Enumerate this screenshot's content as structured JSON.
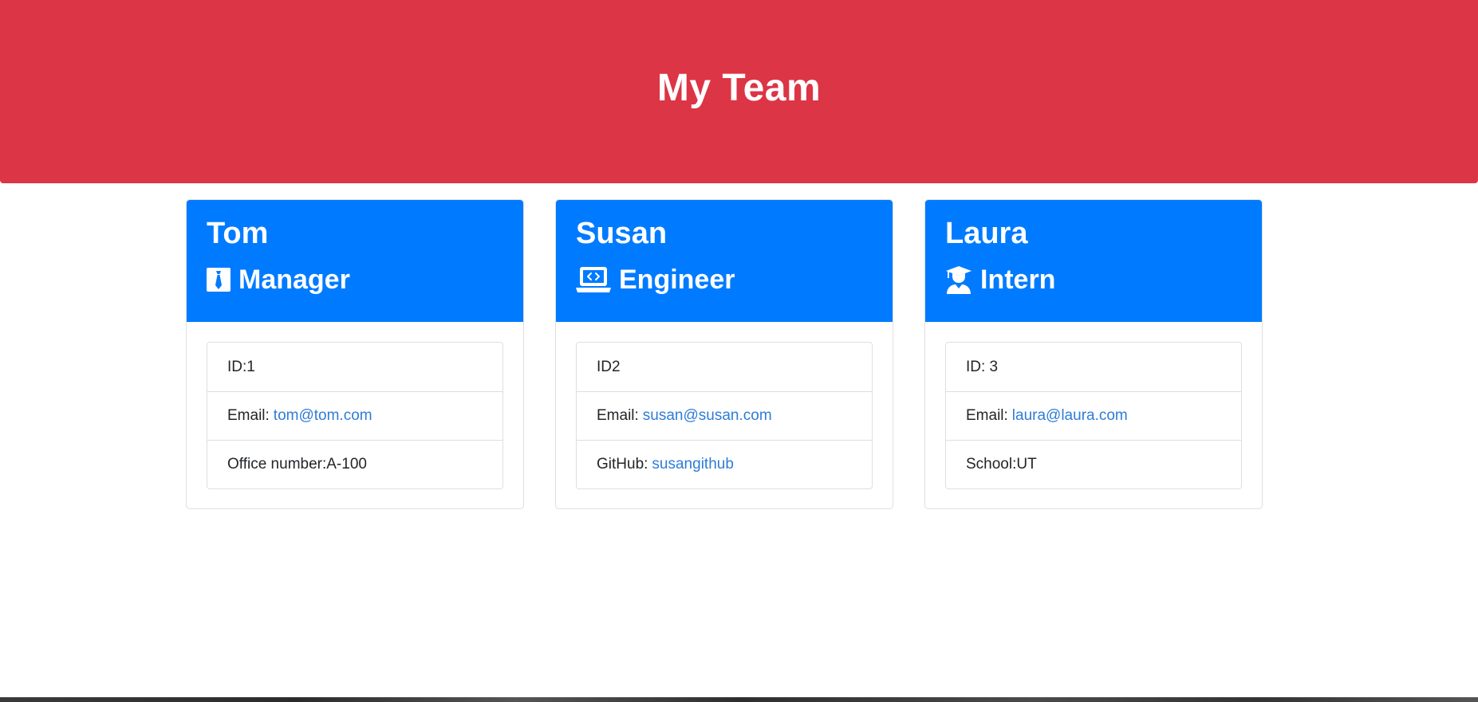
{
  "header": {
    "title": "My Team",
    "color": "#dc3545"
  },
  "accent_color": "#007bff",
  "link_color": "#2f7cd6",
  "cards": [
    {
      "name": "Tom",
      "role": "Manager",
      "role_icon": "tie-icon",
      "details": [
        {
          "label": "ID:1",
          "link": ""
        },
        {
          "label": "Email:",
          "link": "tom@tom.com"
        },
        {
          "label": "Office number:A-100",
          "link": ""
        }
      ]
    },
    {
      "name": "Susan",
      "role": "Engineer",
      "role_icon": "laptop-code-icon",
      "details": [
        {
          "label": "ID2",
          "link": ""
        },
        {
          "label": "Email:",
          "link": "susan@susan.com"
        },
        {
          "label": "GitHub:",
          "link": "susangithub"
        }
      ]
    },
    {
      "name": "Laura",
      "role": "Intern",
      "role_icon": "graduate-icon",
      "details": [
        {
          "label": "ID: 3",
          "link": ""
        },
        {
          "label": "Email:",
          "link": "laura@laura.com"
        },
        {
          "label": "School:UT",
          "link": ""
        }
      ]
    }
  ]
}
